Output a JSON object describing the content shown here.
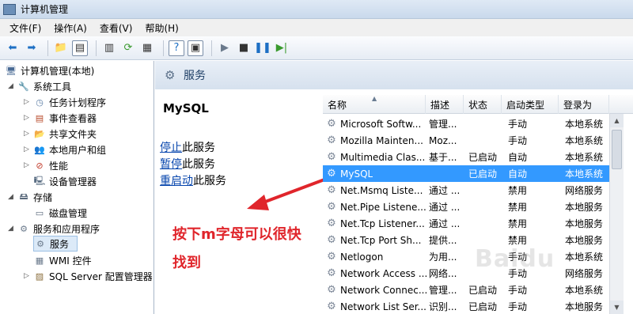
{
  "window": {
    "title": "计算机管理"
  },
  "menu": {
    "items": [
      "文件(F)",
      "操作(A)",
      "查看(V)",
      "帮助(H)"
    ]
  },
  "toolbar": {
    "icons": [
      "back-arrow-icon",
      "forward-arrow-icon",
      "up-folder-icon",
      "show-tree-icon",
      "properties-icon",
      "refresh-icon",
      "export-list-icon",
      "help-icon",
      "console-icon",
      "start-service-icon",
      "stop-service-icon",
      "pause-service-icon",
      "restart-service-icon"
    ]
  },
  "tree": {
    "root": "计算机管理(本地)",
    "system_tools": "系统工具",
    "task_scheduler": "任务计划程序",
    "event_viewer": "事件查看器",
    "shared_folders": "共享文件夹",
    "local_users": "本地用户和组",
    "performance": "性能",
    "device_manager": "设备管理器",
    "storage": "存储",
    "disk_mgmt": "磁盘管理",
    "services_apps": "服务和应用程序",
    "services": "服务",
    "wmi": "WMI 控件",
    "sql_config": "SQL Server 配置管理器"
  },
  "pane": {
    "title": "服务",
    "service_name": "MySQL",
    "actions": [
      {
        "link": "停止",
        "suffix": "此服务"
      },
      {
        "link": "暂停",
        "suffix": "此服务"
      },
      {
        "link": "重启动",
        "suffix": "此服务"
      }
    ]
  },
  "annotation": {
    "line1": "按下m字母可以很快",
    "line2": "找到",
    "color": "#e0252b"
  },
  "list": {
    "columns": [
      "名称",
      "描述",
      "状态",
      "启动类型",
      "登录为"
    ],
    "rows": [
      [
        "Microsoft Softw...",
        "管理...",
        "",
        "手动",
        "本地系统"
      ],
      [
        "Mozilla Mainten...",
        "Moz...",
        "",
        "手动",
        "本地系统"
      ],
      [
        "Multimedia Clas...",
        "基于...",
        "已启动",
        "自动",
        "本地系统"
      ],
      [
        "MySQL",
        "",
        "已启动",
        "自动",
        "本地系统"
      ],
      [
        "Net.Msmq Liste...",
        "通过 ...",
        "",
        "禁用",
        "网络服务"
      ],
      [
        "Net.Pipe Listene...",
        "通过 ...",
        "",
        "禁用",
        "本地服务"
      ],
      [
        "Net.Tcp Listener...",
        "通过 ...",
        "",
        "禁用",
        "本地服务"
      ],
      [
        "Net.Tcp Port Sh...",
        "提供...",
        "",
        "禁用",
        "本地服务"
      ],
      [
        "Netlogon",
        "为用...",
        "",
        "手动",
        "本地系统"
      ],
      [
        "Network Access ...",
        "网络...",
        "",
        "手动",
        "网络服务"
      ],
      [
        "Network Connec...",
        "管理...",
        "已启动",
        "手动",
        "本地系统"
      ],
      [
        "Network List Ser...",
        "识别...",
        "已启动",
        "手动",
        "本地服务"
      ]
    ],
    "selected_index": 3,
    "selection_color": "#3399ff"
  },
  "watermark": "Baidu"
}
